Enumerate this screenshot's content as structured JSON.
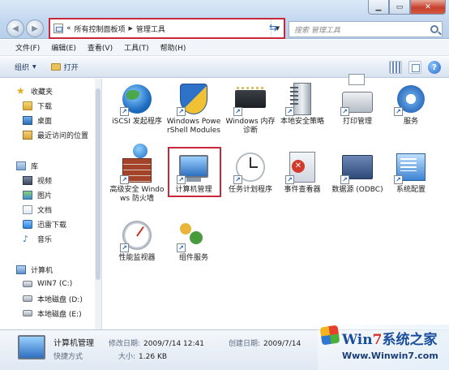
{
  "address": {
    "overflow": "«",
    "crumbs": [
      "所有控制面板项",
      "管理工具"
    ],
    "search_placeholder": "搜索 管理工具"
  },
  "menu": [
    "文件(F)",
    "编辑(E)",
    "查看(V)",
    "工具(T)",
    "帮助(H)"
  ],
  "toolbar": {
    "organize": "组织",
    "open": "打开"
  },
  "sidebar": {
    "favorites": "收藏夹",
    "fav_items": [
      "下载",
      "桌面",
      "最近访问的位置"
    ],
    "libraries": "库",
    "lib_items": [
      "视频",
      "图片",
      "文档",
      "迅雷下载",
      "音乐"
    ],
    "computer": "计算机",
    "drives": [
      "WIN7 (C:)",
      "本地磁盘 (D:)",
      "本地磁盘 (E:)"
    ]
  },
  "items": [
    {
      "label": "iSCSI 发起程序",
      "icon": "iscsi-globe-icon"
    },
    {
      "label": "Windows PowerShell Modules",
      "icon": "powershell-shield-icon"
    },
    {
      "label": "Windows 内存诊断",
      "icon": "memory-chip-icon"
    },
    {
      "label": "本地安全策略",
      "icon": "server-tower-icon"
    },
    {
      "label": "打印管理",
      "icon": "printer-icon"
    },
    {
      "label": "服务",
      "icon": "gears-icon"
    },
    {
      "label": "高级安全 Windows 防火墙",
      "icon": "firewall-icon"
    },
    {
      "label": "计算机管理",
      "icon": "computer-management-icon",
      "selected": true
    },
    {
      "label": "任务计划程序",
      "icon": "clock-icon"
    },
    {
      "label": "事件查看器",
      "icon": "event-viewer-icon"
    },
    {
      "label": "数据源 (ODBC)",
      "icon": "odbc-icon"
    },
    {
      "label": "系统配置",
      "icon": "system-config-icon"
    },
    {
      "label": "性能监视器",
      "icon": "performance-gauge-icon"
    },
    {
      "label": "组件服务",
      "icon": "component-services-icon"
    }
  ],
  "details": {
    "name": "计算机管理",
    "type": "快捷方式",
    "modified_label": "修改日期:",
    "modified_value": "2009/7/14 12:41",
    "size_label": "大小:",
    "size_value": "1.26 KB",
    "created_label": "创建日期:",
    "created_value": "2009/7/14"
  },
  "watermark": {
    "brand_w": "Win",
    "brand_7": "7",
    "brand_rest": "系统之家",
    "url": "Www.Winwin7.com"
  },
  "colors": {
    "highlight": "#c9283a",
    "chrome": "#c2d7ef"
  }
}
